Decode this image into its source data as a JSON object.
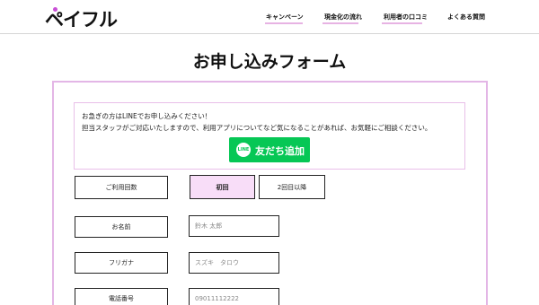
{
  "header": {
    "logo": "ペイフル",
    "nav": [
      {
        "label": "キャンペーン"
      },
      {
        "label": "現金化の流れ"
      },
      {
        "label": "利用者の口コミ"
      },
      {
        "label": "よくある質問"
      }
    ],
    "accent_color": "#e7b3e3"
  },
  "page_title": "お申し込みフォーム",
  "notice": {
    "line1": "お急ぎの方はLINEでお申し込みください！",
    "line2": "担当スタッフがご対応いたしますので、利用アプリについてなど気になることがあれば、お気軽にご相談ください。",
    "line_button": {
      "badge": "LINE",
      "label": "友だち追加",
      "color": "#06c755"
    }
  },
  "form": {
    "usage_count": {
      "label": "ご利用回数",
      "options": [
        {
          "label": "初回",
          "selected": true
        },
        {
          "label": "2回目以降",
          "selected": false
        }
      ]
    },
    "name": {
      "label": "お名前",
      "placeholder": "鈴木 太郎"
    },
    "furigana": {
      "label": "フリガナ",
      "placeholder": "スズキ　タロウ"
    },
    "phone": {
      "label": "電話番号",
      "placeholder": "09011112222"
    }
  }
}
